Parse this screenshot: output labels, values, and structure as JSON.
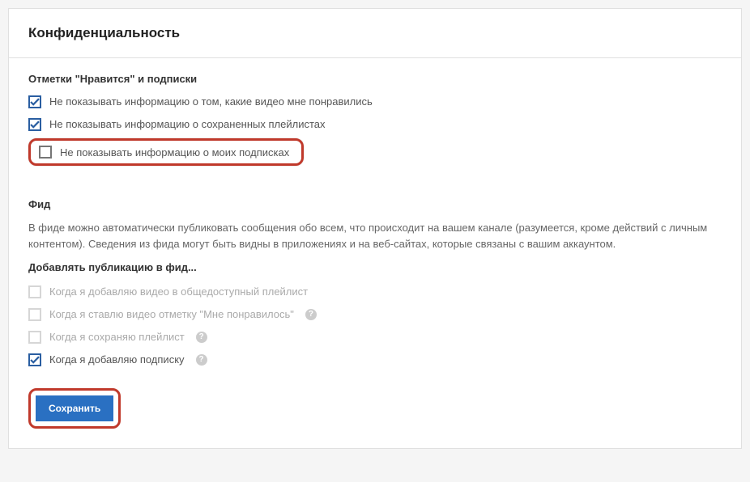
{
  "header": {
    "title": "Конфиденциальность"
  },
  "likes_section": {
    "title": "Отметки \"Нравится\" и подписки",
    "items": [
      {
        "label": "Не показывать информацию о том, какие видео мне понравились",
        "checked": true
      },
      {
        "label": "Не показывать информацию о сохраненных плейлистах",
        "checked": true
      },
      {
        "label": "Не показывать информацию о моих подписках",
        "checked": false
      }
    ]
  },
  "feed_section": {
    "title": "Фид",
    "description": "В фиде можно автоматически публиковать сообщения обо всем, что происходит на вашем канале (разумеется, кроме действий с личным контентом). Сведения из фида могут быть видны в приложениях и на веб-сайтах, которые связаны с вашим аккаунтом.",
    "subtitle": "Добавлять публикацию в фид...",
    "items": [
      {
        "label": "Когда я добавляю видео в общедоступный плейлист",
        "checked": false,
        "disabled": true,
        "help": false
      },
      {
        "label": "Когда я ставлю видео отметку \"Мне понравилось\"",
        "checked": false,
        "disabled": true,
        "help": true
      },
      {
        "label": "Когда я сохраняю плейлист",
        "checked": false,
        "disabled": true,
        "help": true
      },
      {
        "label": "Когда я добавляю подписку",
        "checked": true,
        "disabled": false,
        "help": true
      }
    ]
  },
  "actions": {
    "save": "Сохранить"
  }
}
